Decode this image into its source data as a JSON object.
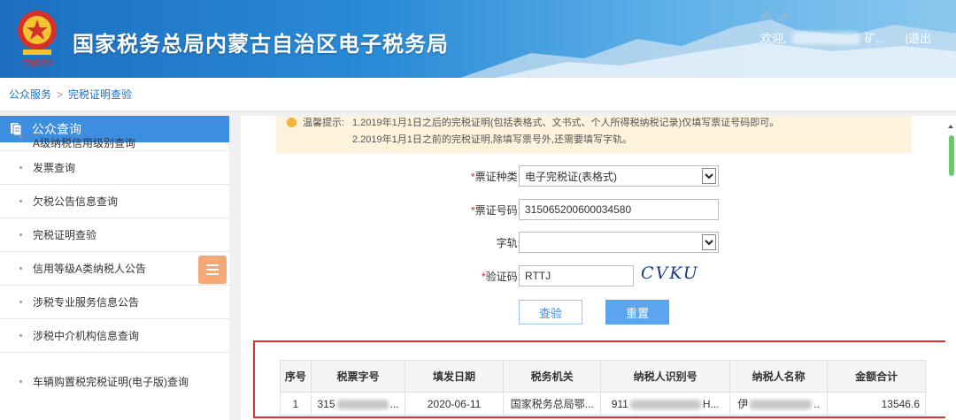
{
  "header": {
    "title": "国家税务总局内蒙古自治区电子税务局",
    "welcome": "欢迎,",
    "user_suffix": "矿...",
    "logout": "|退出",
    "emblem_text": "中国税务"
  },
  "breadcrumb": {
    "home": "公众服务",
    "separator": ">",
    "current": "完税证明查验"
  },
  "sidebar": {
    "heading": "公众查询",
    "items": [
      {
        "label": "A级纳税信用级别查询"
      },
      {
        "label": "发票查询"
      },
      {
        "label": "欠税公告信息查询"
      },
      {
        "label": "完税证明查验"
      },
      {
        "label": "信用等级A类纳税人公告"
      },
      {
        "label": "涉税专业服务信息公告"
      },
      {
        "label": "涉税中介机构信息查询"
      },
      {
        "label": "车辆购置税完税证明(电子版)查询"
      }
    ]
  },
  "notice": {
    "label": "温馨提示:",
    "line1": "1.2019年1月1日之后的完税证明(包括表格式、文书式、个人所得税纳税记录)仅填写票证号码即可。",
    "line2": "2.2019年1月1日之前的完税证明,除填写票号外,还需要填写字轨。"
  },
  "form": {
    "ticket_type": {
      "required": "*",
      "label": "票证种类:",
      "value": "电子完税证(表格式)"
    },
    "ticket_no": {
      "required": "*",
      "label": "票证号码:",
      "value": "315065200600034580"
    },
    "track": {
      "label": "字轨:",
      "value": ""
    },
    "captcha": {
      "required": "*",
      "label": "验证码:",
      "value": "RTTJ",
      "image_text": "CVKU"
    },
    "query_button": "查验",
    "reset_button": "重置"
  },
  "results": {
    "headers": [
      "序号",
      "税票字号",
      "填发日期",
      "税务机关",
      "纳税人识别号",
      "纳税人名称",
      "金额合计"
    ],
    "rows": [
      {
        "seq": "1",
        "ticket_prefix": "315",
        "ticket_suffix": "...",
        "date": "2020-06-11",
        "tax_office": "国家税务总局鄂...",
        "taxpayer_id_prefix": "911",
        "taxpayer_id_suffix": "H...",
        "name_prefix": "伊",
        "name_suffix": "..",
        "amount": "13546.6"
      }
    ]
  },
  "colors": {
    "header_blue": "#1d6fc0",
    "sidebar_head": "#3d8de0",
    "notice_bg": "#fdf3dc",
    "highlight_border": "#e03030"
  }
}
